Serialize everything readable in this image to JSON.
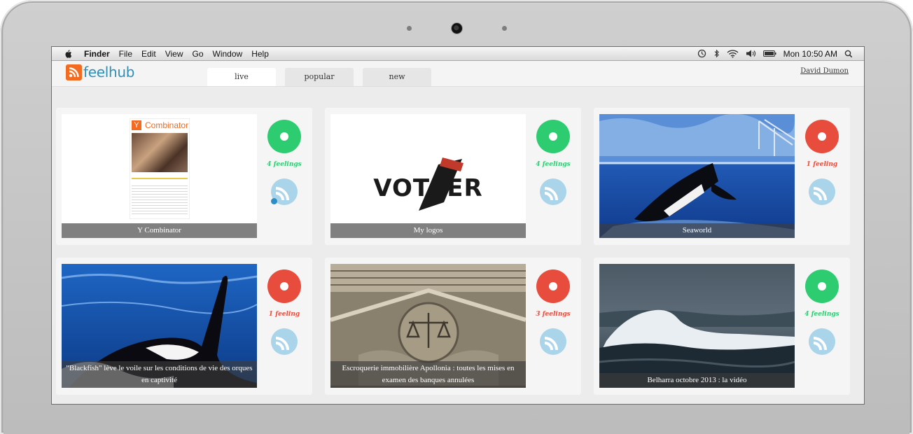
{
  "menubar": {
    "items": [
      "Finder",
      "File",
      "Edit",
      "View",
      "Go",
      "Window",
      "Help"
    ],
    "clock": "Mon 10:50 AM"
  },
  "app": {
    "logo_text": "feelhub",
    "tabs": [
      "live",
      "popular",
      "new"
    ],
    "active_tab": "live",
    "user": "David Dumon"
  },
  "colors": {
    "green": "#2ecc71",
    "red": "#e74c3c",
    "brand_orange": "#f26b21",
    "brand_blue": "#2e8fb8",
    "rss_blue": "#a9d4ea"
  },
  "cards": [
    {
      "title": "Y Combinator",
      "feelings": "4 feelings",
      "mood": "green",
      "subscribed": true,
      "thumb_logo": "Y",
      "thumb_heading": "Combinator"
    },
    {
      "title": "My logos",
      "feelings": "4 feelings",
      "mood": "green",
      "subscribed": false,
      "thumb_text": "VOTEER"
    },
    {
      "title": "Seaworld",
      "feelings": "1 feeling",
      "mood": "red",
      "subscribed": false
    },
    {
      "title": "\"Blackfish\" lève le voile sur les conditions de vie des orques en captivité",
      "feelings": "1 feeling",
      "mood": "red",
      "subscribed": false
    },
    {
      "title": "Escroquerie immobilière Apollonia : toutes les mises en examen des banques annulées",
      "feelings": "3 feelings",
      "mood": "red",
      "subscribed": false
    },
    {
      "title": "Belharra octobre 2013 : la vidéo",
      "feelings": "4 feelings",
      "mood": "green",
      "subscribed": false
    }
  ]
}
